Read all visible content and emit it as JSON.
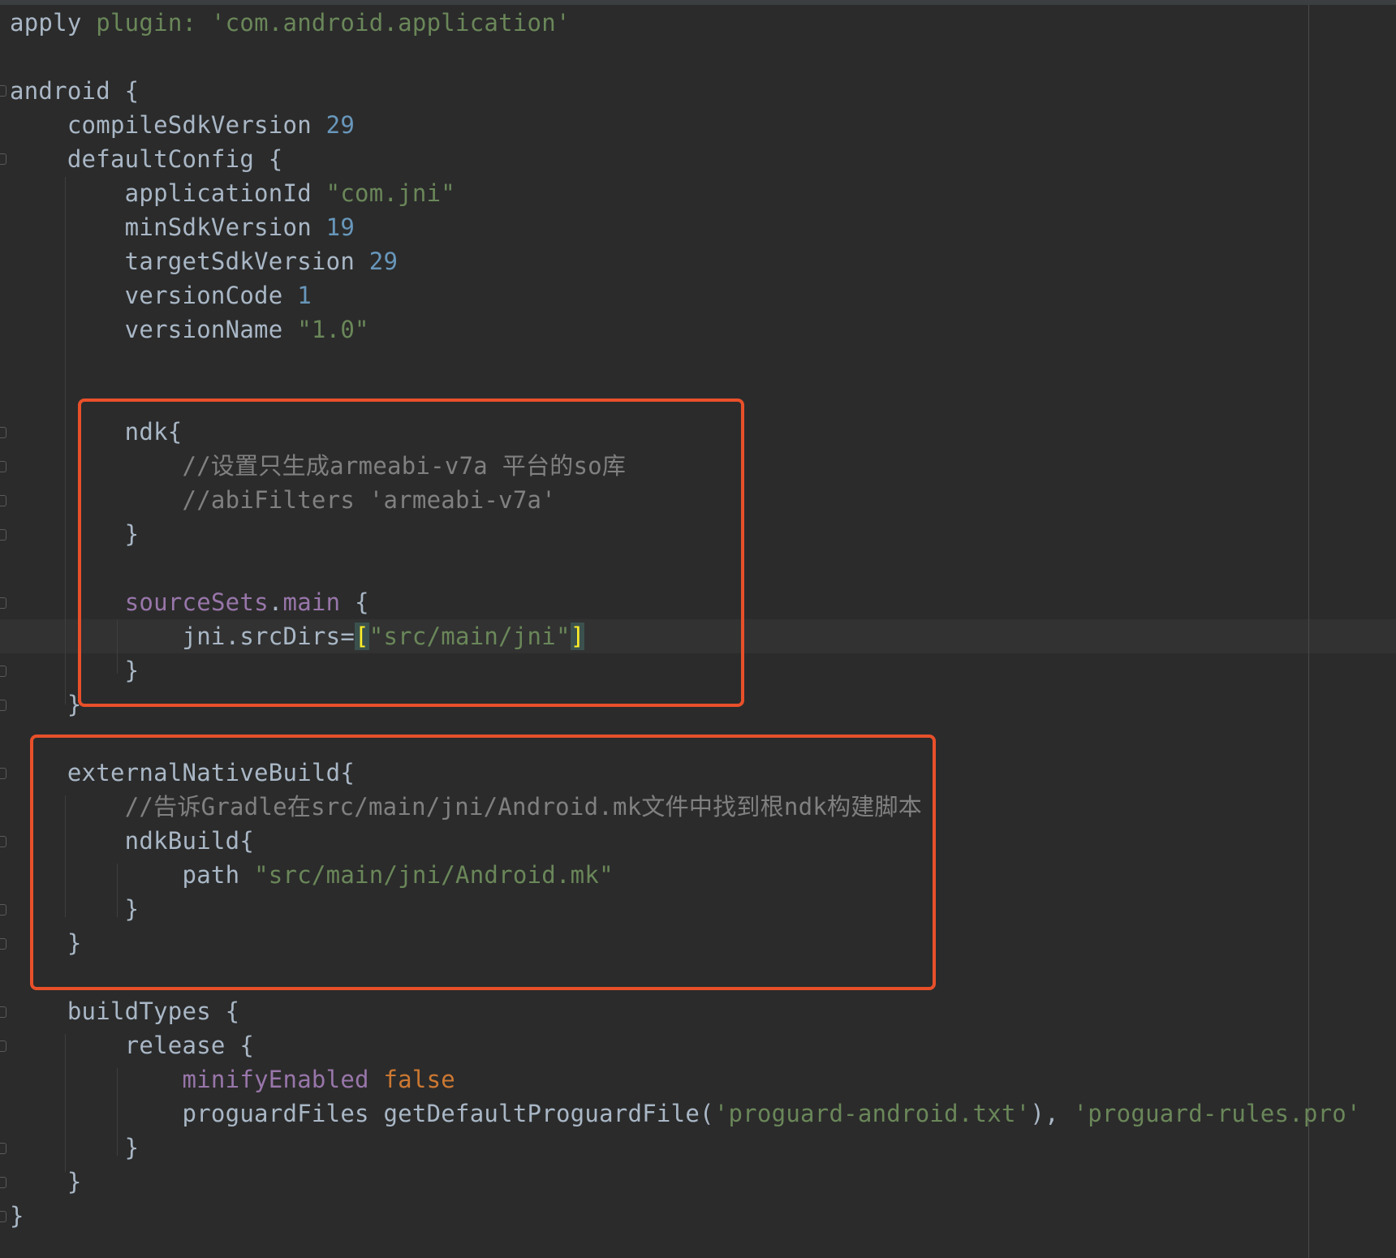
{
  "editor": {
    "language": "groovy",
    "colors": {
      "background": "#2b2b2b",
      "text": "#a9b7c6",
      "string": "#6a8759",
      "number": "#6897bb",
      "keyword": "#cc7832",
      "comment": "#808080",
      "property": "#9876aa",
      "bracket_match": "#ffef28",
      "highlight_box": "#e8502a"
    },
    "lines": {
      "l1": {
        "a": "apply ",
        "b": "plugin:",
        "c": " ",
        "d": "'com.android.application'"
      },
      "l3": {
        "a": "android {"
      },
      "l4": {
        "a": "    compileSdkVersion ",
        "b": "29"
      },
      "l5": {
        "a": "    defaultConfig {"
      },
      "l6": {
        "a": "        applicationId ",
        "b": "\"com.jni\""
      },
      "l7": {
        "a": "        minSdkVersion ",
        "b": "19"
      },
      "l8": {
        "a": "        targetSdkVersion ",
        "b": "29"
      },
      "l9": {
        "a": "        versionCode ",
        "b": "1"
      },
      "l10": {
        "a": "        versionName ",
        "b": "\"1.0\""
      },
      "l13": {
        "a": "        ndk{"
      },
      "l14": {
        "a": "            ",
        "b": "//设置只生成armeabi-v7a 平台的so库"
      },
      "l15": {
        "a": "            ",
        "b": "//abiFilters 'armeabi-v7a'"
      },
      "l16": {
        "a": "        }"
      },
      "l18": {
        "a": "        ",
        "b": "sourceSets",
        "c": ".",
        "d": "main",
        "e": " {"
      },
      "l19": {
        "a": "            jni.srcDirs=",
        "b": "[",
        "c": "\"src/main/jni\"",
        "d": "]"
      },
      "l20": {
        "a": "        }"
      },
      "l21": {
        "a": "    }"
      },
      "l23": {
        "a": "    externalNativeBuild{"
      },
      "l24": {
        "a": "        ",
        "b": "//告诉Gradle在src/main/jni/Android.mk文件中找到根ndk构建脚本"
      },
      "l25": {
        "a": "        ndkBuild{"
      },
      "l26": {
        "a": "            path ",
        "b": "\"src/main/jni/Android.mk\""
      },
      "l27": {
        "a": "        }"
      },
      "l28": {
        "a": "    }"
      },
      "l30": {
        "a": "    buildTypes {"
      },
      "l31": {
        "a": "        release {"
      },
      "l32": {
        "a": "            ",
        "b": "minifyEnabled",
        "c": " ",
        "d": "false"
      },
      "l33": {
        "a": "            proguardFiles getDefaultProguardFile(",
        "b": "'proguard-android.txt'",
        "c": "), ",
        "d": "'proguard-rules.pro'"
      },
      "l34": {
        "a": "        }"
      },
      "l35": {
        "a": "    }"
      },
      "l36": {
        "a": "}"
      }
    }
  }
}
